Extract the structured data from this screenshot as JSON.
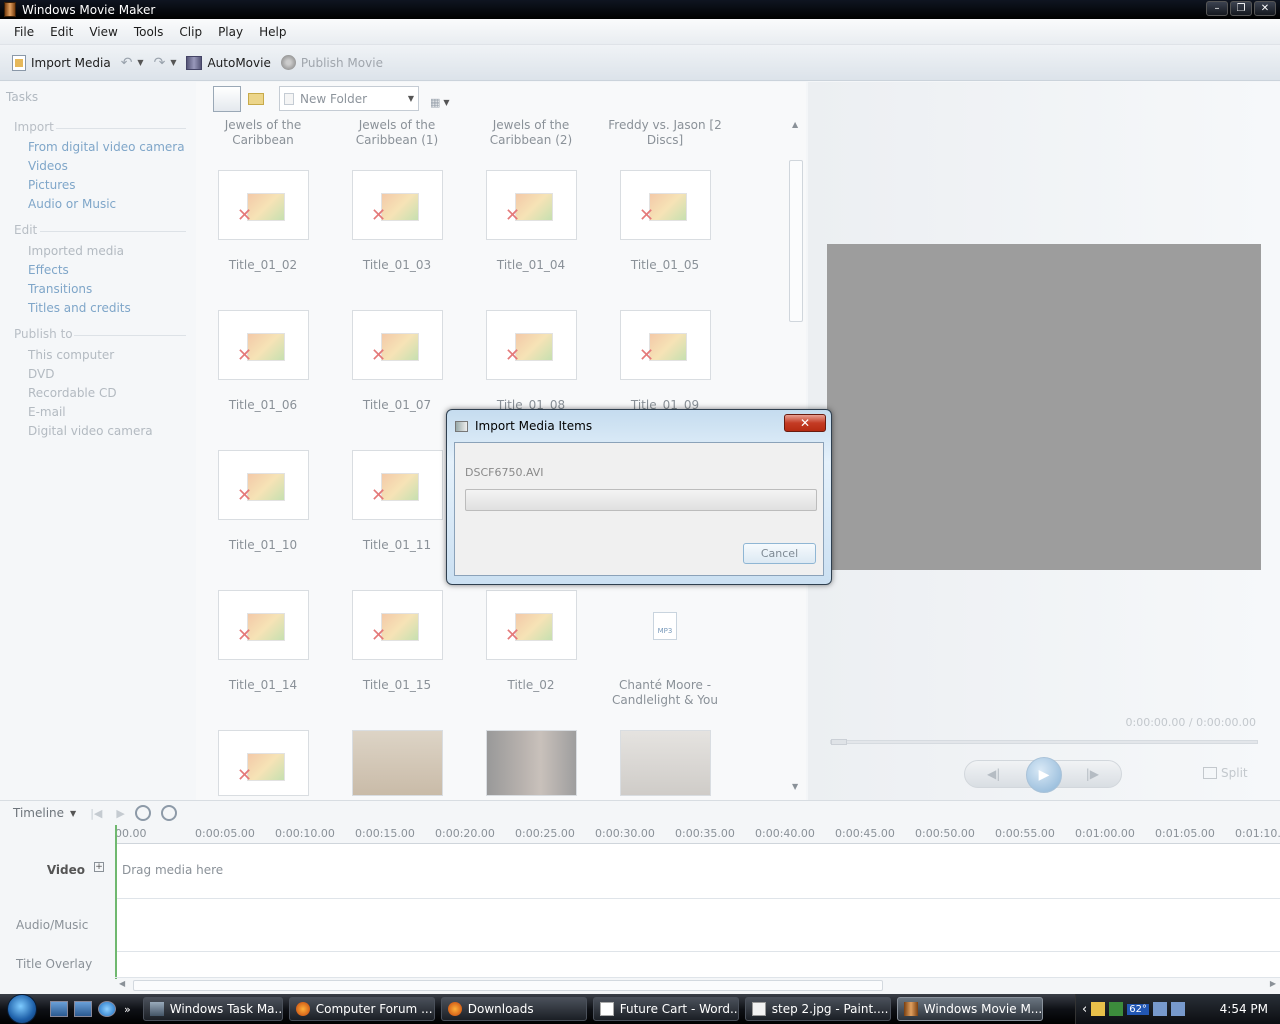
{
  "window": {
    "title": "Windows Movie Maker"
  },
  "menu": [
    "File",
    "Edit",
    "View",
    "Tools",
    "Clip",
    "Play",
    "Help"
  ],
  "toolbar": {
    "import_label": "Import Media",
    "automovie_label": "AutoMovie",
    "publish_label": "Publish Movie"
  },
  "tasks": {
    "heading": "Tasks",
    "sections": [
      {
        "label": "Import",
        "items": [
          "From digital video camera",
          "Videos",
          "Pictures",
          "Audio or Music"
        ]
      },
      {
        "label": "Edit",
        "items": [
          "Imported media",
          "Effects",
          "Transitions",
          "Titles and credits"
        ]
      },
      {
        "label": "Publish to",
        "items": [
          "This computer",
          "DVD",
          "Recordable CD",
          "E-mail",
          "Digital video camera"
        ]
      }
    ]
  },
  "collection": {
    "folder": "New Folder",
    "top_labels": [
      "Jewels of the Caribbean",
      "Jewels of the Caribbean (1)",
      "Jewels of the Caribbean (2)",
      "Freddy vs. Jason [2 Discs]"
    ],
    "clips": [
      "Title_01_02",
      "Title_01_03",
      "Title_01_04",
      "Title_01_05",
      "Title_01_06",
      "Title_01_07",
      "Title_01_08",
      "Title_01_09",
      "Title_01_10",
      "Title_01_11",
      "",
      "",
      "Title_01_14",
      "Title_01_15",
      "Title_02",
      "Chanté Moore - Candlelight & You"
    ],
    "mp3_badge": "MP3"
  },
  "preview": {
    "timecode": "0:00:00.00 / 0:00:00.00",
    "split_label": "Split"
  },
  "timeline": {
    "mode_label": "Timeline",
    "ticks": [
      "00.00",
      "0:00:05.00",
      "0:00:10.00",
      "0:00:15.00",
      "0:00:20.00",
      "0:00:25.00",
      "0:00:30.00",
      "0:00:35.00",
      "0:00:40.00",
      "0:00:45.00",
      "0:00:50.00",
      "0:00:55.00",
      "0:01:00.00",
      "0:01:05.00",
      "0:01:10.00"
    ],
    "tracks": {
      "video": "Video",
      "audio": "Audio/Music",
      "title": "Title Overlay"
    },
    "drag_hint": "Drag media here"
  },
  "dialog": {
    "title": "Import Media Items",
    "filename": "DSCF6750.AVI",
    "progress": 0,
    "cancel_label": "Cancel"
  },
  "taskbar": {
    "tasks": [
      {
        "label": "Windows Task Ma...",
        "icon": "task-manager-icon"
      },
      {
        "label": "Computer Forum ...",
        "icon": "firefox-icon"
      },
      {
        "label": "Downloads",
        "icon": "firefox-icon"
      },
      {
        "label": "Future Cart - Word...",
        "icon": "word-icon"
      },
      {
        "label": "step 2.jpg - Paint....",
        "icon": "paint-icon"
      },
      {
        "label": "Windows Movie M...",
        "icon": "movie-maker-icon"
      }
    ],
    "temperature": "62°",
    "clock": "4:54 PM"
  }
}
